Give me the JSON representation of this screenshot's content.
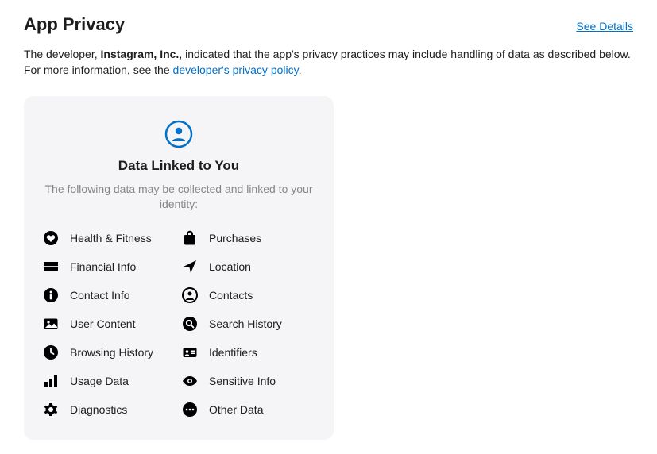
{
  "header": {
    "title": "App Privacy",
    "see_details": "See Details"
  },
  "description": {
    "prefix": "The developer, ",
    "developer": "Instagram, Inc.",
    "middle": ", indicated that the app's privacy practices may include handling of data as described below. For more information, see the ",
    "link_text": "developer's privacy policy",
    "suffix": "."
  },
  "card": {
    "title": "Data Linked to You",
    "subtitle": "The following data may be collected and linked to your identity:",
    "items": [
      {
        "icon": "heart",
        "label": "Health & Fitness"
      },
      {
        "icon": "bag",
        "label": "Purchases"
      },
      {
        "icon": "credit-card",
        "label": "Financial Info"
      },
      {
        "icon": "location-arrow",
        "label": "Location"
      },
      {
        "icon": "info-circle",
        "label": "Contact Info"
      },
      {
        "icon": "person-circle",
        "label": "Contacts"
      },
      {
        "icon": "image",
        "label": "User Content"
      },
      {
        "icon": "magnify-circle",
        "label": "Search History"
      },
      {
        "icon": "clock",
        "label": "Browsing History"
      },
      {
        "icon": "id-card",
        "label": "Identifiers"
      },
      {
        "icon": "bar-chart",
        "label": "Usage Data"
      },
      {
        "icon": "eye",
        "label": "Sensitive Info"
      },
      {
        "icon": "gear",
        "label": "Diagnostics"
      },
      {
        "icon": "ellipsis-circle",
        "label": "Other Data"
      }
    ]
  }
}
